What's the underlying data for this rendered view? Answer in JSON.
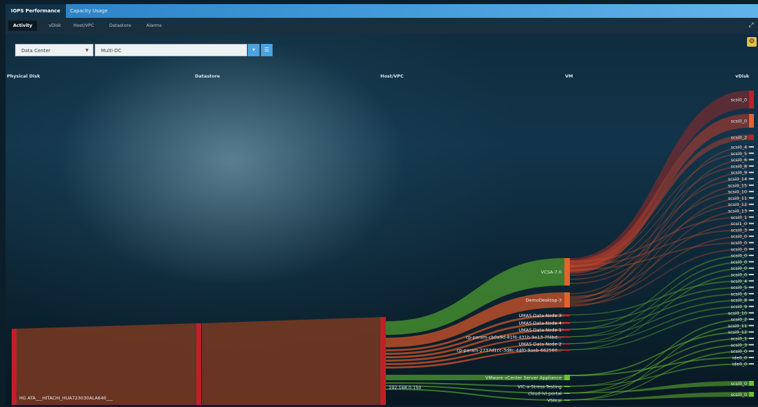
{
  "tabs": {
    "main": [
      "IOPS Performance",
      "Capacity Usage"
    ],
    "sub": [
      "Activity",
      "vDisk",
      "Host/VPC",
      "Datastore",
      "Alarms"
    ]
  },
  "filters": {
    "scope_select": "Data Center",
    "target_select": "Multi-DC"
  },
  "columns": {
    "physical_disk": "Physical Disk",
    "datastore": "Datastore",
    "host": "Host/VPC",
    "vm": "VM",
    "vdisk": "vDisk"
  },
  "nodes": {
    "physical_disk_label": "HG ATA___HITACHI_HUA723030ALA640___",
    "host_label": "192.168.0.150",
    "vms": [
      "VCSA-7.0",
      "DemoDesktop-3",
      "UMAS-Data-Node-3",
      "UMAS-Data-Node-4",
      "UMAS-Data-Node-1",
      "cp-param-cb0a9d-81f6-431b-9e13-7f4bd...",
      "UMAS-Data-Node-2",
      "cp-param-2737d1cc-3d8c-44f0-9aeb-662560...",
      "VMware vCenter Server Appliance",
      "VIC-a-Stress-Testing",
      "cloud-lvl-portal",
      "VSIIcsi"
    ],
    "vdisks": [
      "scsi0_0",
      "scsi0_0",
      "scsi0_2",
      "scsi0_4",
      "scsi0_5",
      "scsi0_6",
      "scsi0_8",
      "scsi0_9",
      "scsi0_14",
      "scsi0_15",
      "scsi0_10",
      "scsi0_11",
      "scsi0_12",
      "scsi0_13",
      "scsi0_1",
      "scsi1_0",
      "scsi0_3",
      "scsi0_0",
      "scsi0_0",
      "scsi0_0",
      "scsi0_0",
      "scsi0_0",
      "scsi0_0",
      "scsi0_0",
      "scsi0_4",
      "scsi0_5",
      "scsi0_6",
      "scsi0_8",
      "scsi0_9",
      "scsi0_10",
      "scsi0_2",
      "scsi0_11",
      "scsi0_12",
      "scsi0_1",
      "scsi0_3",
      "scsi0_0",
      "ide0_0",
      "ide0_0",
      "scsi0_0",
      "scsi0_0"
    ]
  },
  "colors": {
    "flow_brown": "#7a3a22",
    "flow_orange": "#d2542a",
    "flow_green": "#4c9a2f",
    "node_red": "#c0202a",
    "node_orange": "#e3632a",
    "node_green": "#6cc12f",
    "accent_blue": "#4aa3e2",
    "gear_yellow": "#e6c04a"
  }
}
